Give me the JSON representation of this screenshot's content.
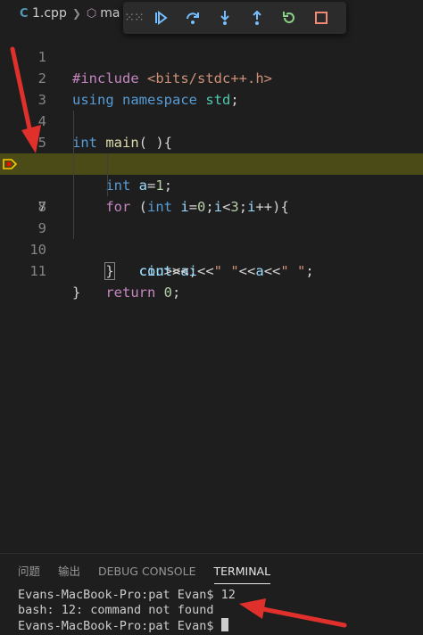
{
  "breadcrumb": {
    "file_icon": "c-file-icon",
    "file": "1.cpp",
    "symbol_icon": "cube-icon",
    "symbol": "ma"
  },
  "debug_toolbar": {
    "buttons": [
      "drag-grip-icon",
      "continue-icon",
      "step-over-icon",
      "step-into-icon",
      "step-out-icon",
      "restart-icon",
      "stop-icon"
    ],
    "colors": {
      "blue": "#75beff",
      "green": "#89d185",
      "red": "#f48771"
    }
  },
  "editor": {
    "current_line": 7,
    "lines": [
      {
        "n": "1",
        "text": "#include <bits/stdc++.h>"
      },
      {
        "n": "2",
        "text": "using namespace std;"
      },
      {
        "n": "3",
        "text": ""
      },
      {
        "n": "4",
        "text": "int main( ){"
      },
      {
        "n": "5",
        "text": "    int a=1;"
      },
      {
        "n": "6",
        "text": "    for (int i=0;i<3;i++){"
      },
      {
        "n": "7",
        "text": "        cin>>a;"
      },
      {
        "n": "8",
        "text": "        cout<<i<<\" \"<<a<<\" \";"
      },
      {
        "n": "9",
        "text": "    }"
      },
      {
        "n": "10",
        "text": "    return 0;"
      },
      {
        "n": "11",
        "text": "}"
      }
    ]
  },
  "panel": {
    "tabs": [
      "问题",
      "输出",
      "DEBUG CONSOLE",
      "TERMINAL"
    ],
    "active_tab": "TERMINAL",
    "terminal_lines": [
      "Evans-MacBook-Pro:pat Evan$ 12",
      "bash: 12: command not found",
      "Evans-MacBook-Pro:pat Evan$ "
    ]
  },
  "annotation_color": "#e0302c"
}
